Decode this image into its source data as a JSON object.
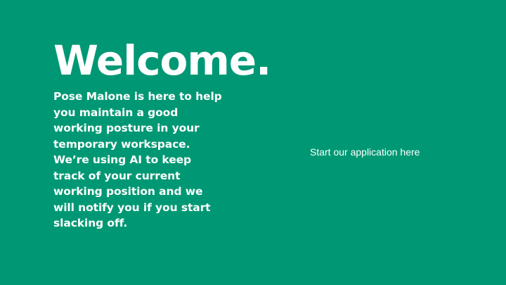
{
  "page": {
    "background_color": "#009874",
    "text_color": "#ffffff"
  },
  "hero": {
    "title": "Welcome.",
    "description": "Pose Malone is here to help\nyou maintain a good\nworking posture in your\ntemporary workspace.\nWe’re using AI to keep\ntrack of your current\nworking position and we\nwill notify you if you start\nslacking off."
  },
  "cta": {
    "label": "Start our application here"
  }
}
